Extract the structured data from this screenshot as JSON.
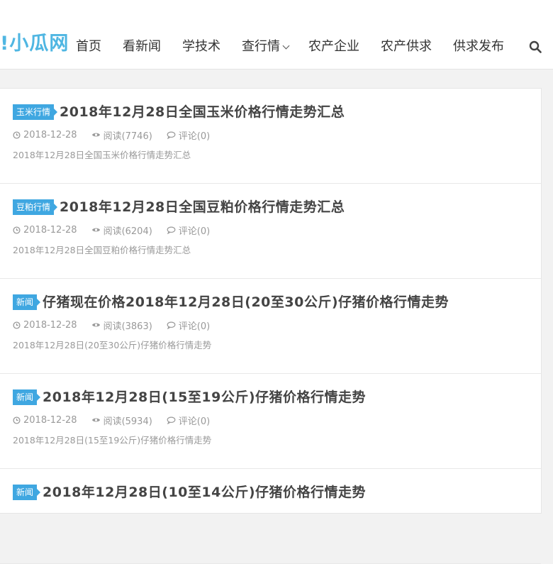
{
  "header": {
    "logo_text": "!小瓜网",
    "nav": [
      {
        "label": "首页"
      },
      {
        "label": "看新闻"
      },
      {
        "label": "学技术"
      },
      {
        "label": "查行情",
        "has_dropdown": true
      },
      {
        "label": "农产企业"
      },
      {
        "label": "农产供求"
      },
      {
        "label": "供求发布"
      }
    ],
    "search_icon": "search-icon"
  },
  "colors": {
    "accent": "#3fa7e1",
    "logo": "#4fb6e2",
    "meta_text": "#999999"
  },
  "articles": [
    {
      "tag": "玉米行情",
      "title": "2018年12月28日全国玉米价格行情走势汇总",
      "date": "2018-12-28",
      "views": "阅读(7746)",
      "comments": "评论(0)",
      "summary": "2018年12月28日全国玉米价格行情走势汇总"
    },
    {
      "tag": "豆粕行情",
      "title": "2018年12月28日全国豆粕价格行情走势汇总",
      "date": "2018-12-28",
      "views": "阅读(6204)",
      "comments": "评论(0)",
      "summary": "2018年12月28日全国豆粕价格行情走势汇总"
    },
    {
      "tag": "新闻",
      "title": "仔猪现在价格2018年12月28日(20至30公斤)仔猪价格行情走势",
      "date": "2018-12-28",
      "views": "阅读(3863)",
      "comments": "评论(0)",
      "summary": "2018年12月28日(20至30公斤)仔猪价格行情走势"
    },
    {
      "tag": "新闻",
      "title": "2018年12月28日(15至19公斤)仔猪价格行情走势",
      "date": "2018-12-28",
      "views": "阅读(5934)",
      "comments": "评论(0)",
      "summary": "2018年12月28日(15至19公斤)仔猪价格行情走势"
    },
    {
      "tag": "新闻",
      "title": "2018年12月28日(10至14公斤)仔猪价格行情走势"
    }
  ]
}
